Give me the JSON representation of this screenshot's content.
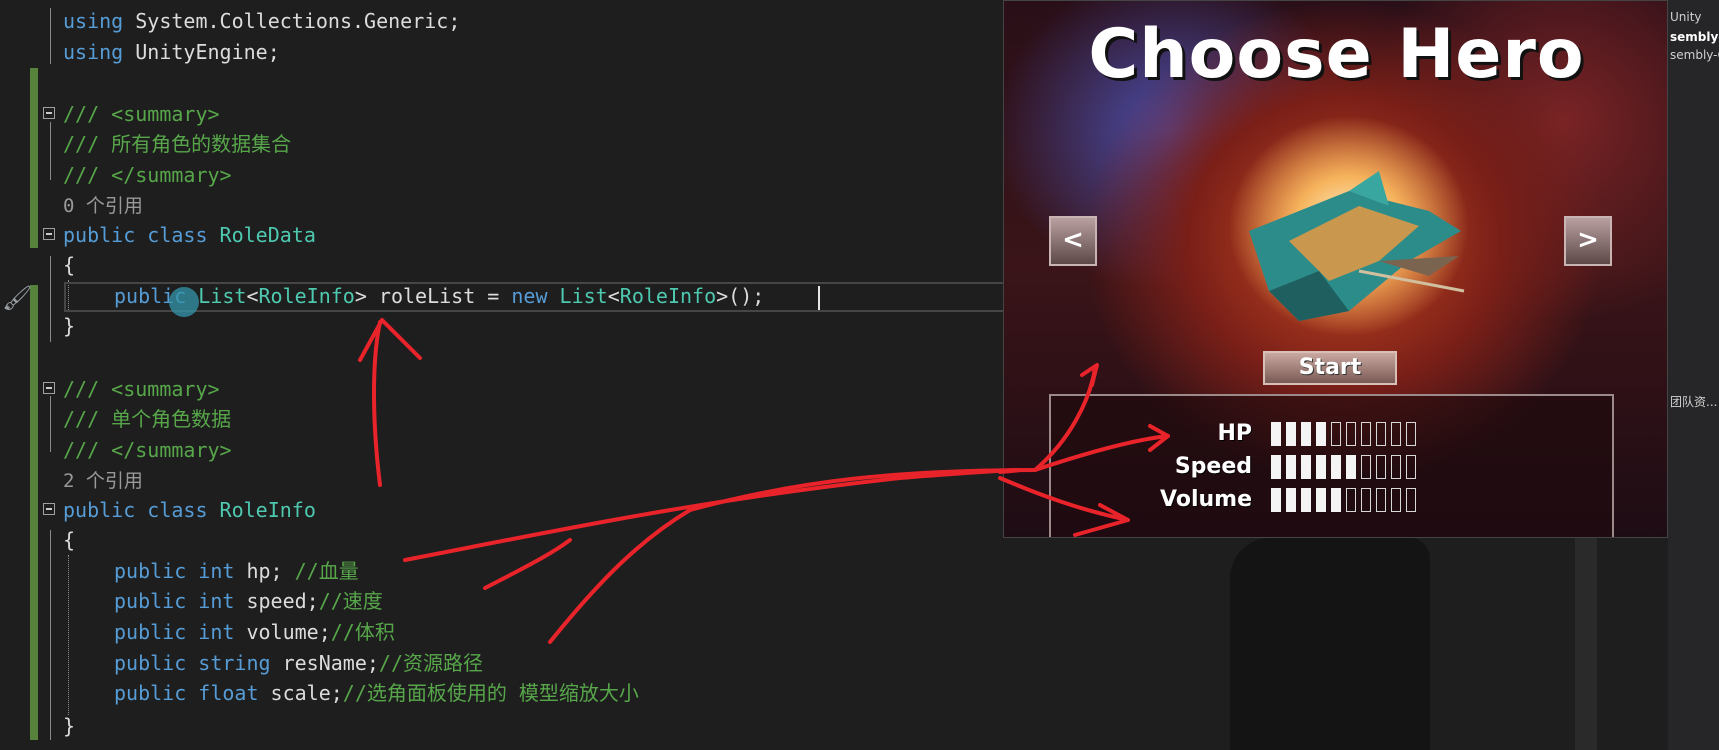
{
  "editor": {
    "lines": {
      "l1_kw": "using",
      "l1_rest": " System.Collections.Generic;",
      "l2_kw": "using",
      "l2_rest": " UnityEngine;",
      "sum1_open": "/// <summary>",
      "sum1_text": "/// 所有角色的数据集合",
      "sum1_close": "/// </summary>",
      "ref1": "0 个引用",
      "class1_kw": "public class",
      "class1_name": " RoleData",
      "brace_open1": "{",
      "field_kw": "public",
      "field_type1": " List",
      "field_lt": "<",
      "field_gen": "RoleInfo",
      "field_gt": ">",
      "field_name": " roleList = ",
      "field_new": "new",
      "field_type2": " List",
      "field_lt2": "<",
      "field_gen2": "RoleInfo",
      "field_end": ">();",
      "brace_close1": "}",
      "sum2_open": "/// <summary>",
      "sum2_text": "/// 单个角色数据",
      "sum2_close": "/// </summary>",
      "ref2": "2 个引用",
      "class2_kw": "public class",
      "class2_name": " RoleInfo",
      "brace_open2": "{",
      "hp_kw": "public int",
      "hp_rest": " hp; ",
      "hp_cm": "//血量",
      "speed_kw": "public int",
      "speed_rest": " speed;",
      "speed_cm": "//速度",
      "volume_kw": "public int",
      "volume_rest": " volume;",
      "volume_cm": "//体积",
      "res_kw": "public string",
      "res_rest": " resName;",
      "res_cm": "//资源路径",
      "scale_kw": "public float",
      "scale_rest": " scale;",
      "scale_cm": "//选角面板使用的 模型缩放大小",
      "brace_close2": "}"
    }
  },
  "game": {
    "title": "Choose Hero",
    "prev_label": "<",
    "next_label": ">",
    "start_label": "Start",
    "stats": [
      {
        "label": "HP",
        "filled": 4,
        "total": 10
      },
      {
        "label": "Speed",
        "filled": 6,
        "total": 10
      },
      {
        "label": "Volume",
        "filled": 5,
        "total": 10
      }
    ]
  },
  "right_panel": {
    "t1": "Unity",
    "t2": "sembly-C",
    "t3": "sembly-C",
    "t4": "团队资..."
  },
  "colors": {
    "keyword": "#569cd6",
    "type": "#4ec9b0",
    "comment": "#57a64a",
    "annotation": "#e8232a"
  }
}
